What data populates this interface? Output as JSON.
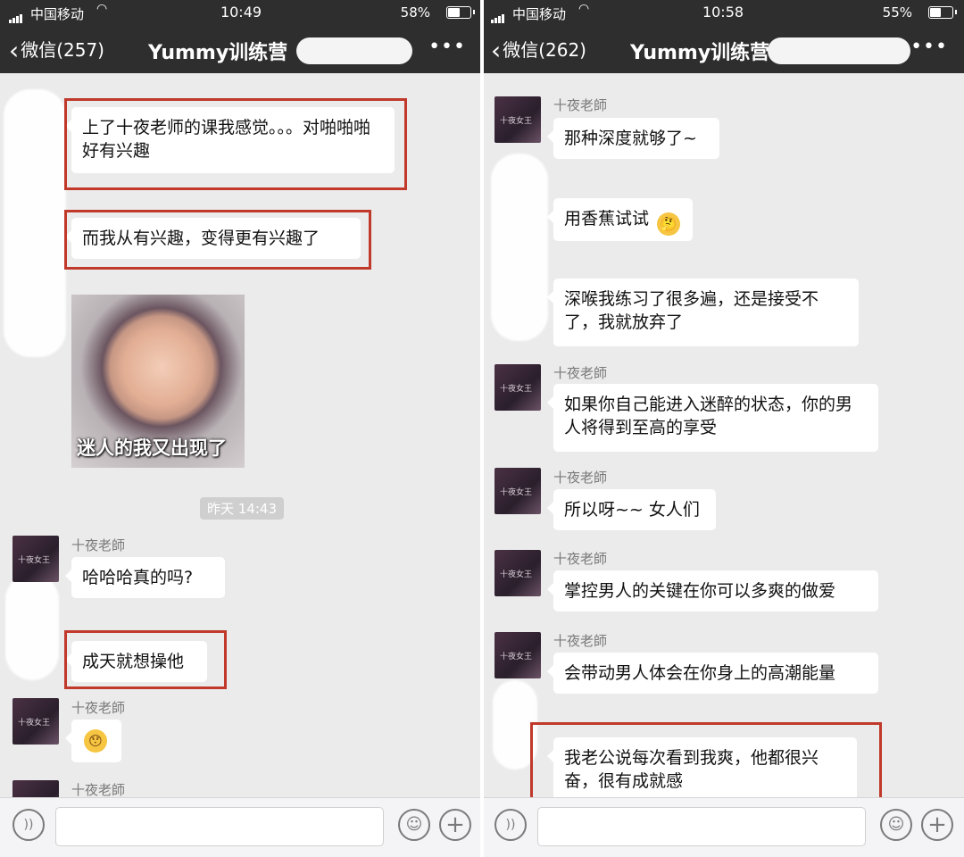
{
  "left": {
    "status": {
      "carrier": "中国移动",
      "time": "10:49",
      "battery": "58%",
      "battery_level": 0.58
    },
    "nav": {
      "back_label": "微信(257)",
      "title": "Yummy训练营",
      "more": "•••"
    },
    "messages": [
      {
        "text": "上了十夜老师的课我感觉。。。对啪啪啪好有兴趣"
      },
      {
        "text": "而我从有兴趣，变得更有兴趣了"
      },
      {
        "sticker_caption": "迷人的我又出现了"
      },
      {
        "timestamp": "昨天 14:43"
      },
      {
        "sender": "十夜老師",
        "text": "哈哈哈真的吗?"
      },
      {
        "text": "成天就想操他"
      },
      {
        "sender": "十夜老師",
        "emoji": "😯"
      },
      {
        "sender": "十夜老師"
      }
    ],
    "avatar_text": "十夜女王"
  },
  "right": {
    "status": {
      "carrier": "中国移动",
      "time": "10:58",
      "battery": "55%",
      "battery_level": 0.55
    },
    "nav": {
      "back_label": "微信(262)",
      "title": "Yummy训练营",
      "more": "•••"
    },
    "messages": [
      {
        "sender": "十夜老師",
        "text": "那种深度就够了~"
      },
      {
        "text": "用香蕉试试",
        "emoji": "🤔"
      },
      {
        "text": "深喉我练习了很多遍，还是接受不了，我就放弃了"
      },
      {
        "sender": "十夜老師",
        "text": "如果你自己能进入迷醉的状态，你的男人将得到至高的享受"
      },
      {
        "sender": "十夜老師",
        "text": "所以呀~~ 女人们"
      },
      {
        "sender": "十夜老師",
        "text": "掌控男人的关键在你可以多爽的做爱"
      },
      {
        "sender": "十夜老師",
        "text": "会带动男人体会在你身上的高潮能量"
      },
      {
        "text": "我老公说每次看到我爽，他都很兴奋，很有成就感"
      }
    ],
    "avatar_text": "十夜女王"
  },
  "colors": {
    "nav_bg": "#2e2e2e",
    "chat_bg": "#ebebeb",
    "highlight_box": "#c0392b"
  }
}
